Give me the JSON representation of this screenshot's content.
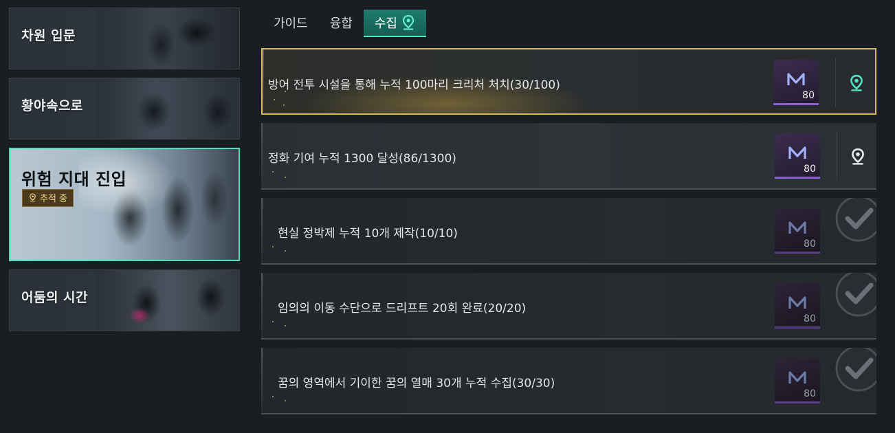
{
  "sidebar": {
    "chapters": [
      {
        "title": "차원 입문"
      },
      {
        "title": "황야속으로"
      },
      {
        "title": "위험 지대 진입",
        "badge": "추적 중"
      },
      {
        "title": "어둠의 시간"
      }
    ]
  },
  "tabs": [
    {
      "label": "가이드"
    },
    {
      "label": "융합"
    },
    {
      "label": "수집"
    }
  ],
  "quests": [
    {
      "text": "방어 전투 시설을 통해 누적 100마리 크리처 처치(30/100)",
      "reward_qty": "80",
      "status": "tracking"
    },
    {
      "text": "정화 기여 누적 1300 달성(86/1300)",
      "reward_qty": "80",
      "status": "in-progress"
    },
    {
      "text": "현실 정박제 누적 10개 제작(10/10)",
      "reward_qty": "80",
      "status": "complete"
    },
    {
      "text": "임의의 이동 수단으로 드리프트 20회 완료(20/20)",
      "reward_qty": "80",
      "status": "complete"
    },
    {
      "text": "꿈의 영역에서 기이한 꿈의 열매 30개 누적 수집(30/30)",
      "reward_qty": "80",
      "status": "complete"
    }
  ],
  "colors": {
    "accent": "#4fe0b8",
    "highlight_border": "#d8bb55",
    "reward_bar": "#8c5fd6",
    "badge_text": "#f3d48a"
  },
  "icons": {
    "tab_collect": "location-pin-icon",
    "reward": "currency-n-icon",
    "complete": "checkmark-icon",
    "tracking": "location-pin-icon"
  }
}
